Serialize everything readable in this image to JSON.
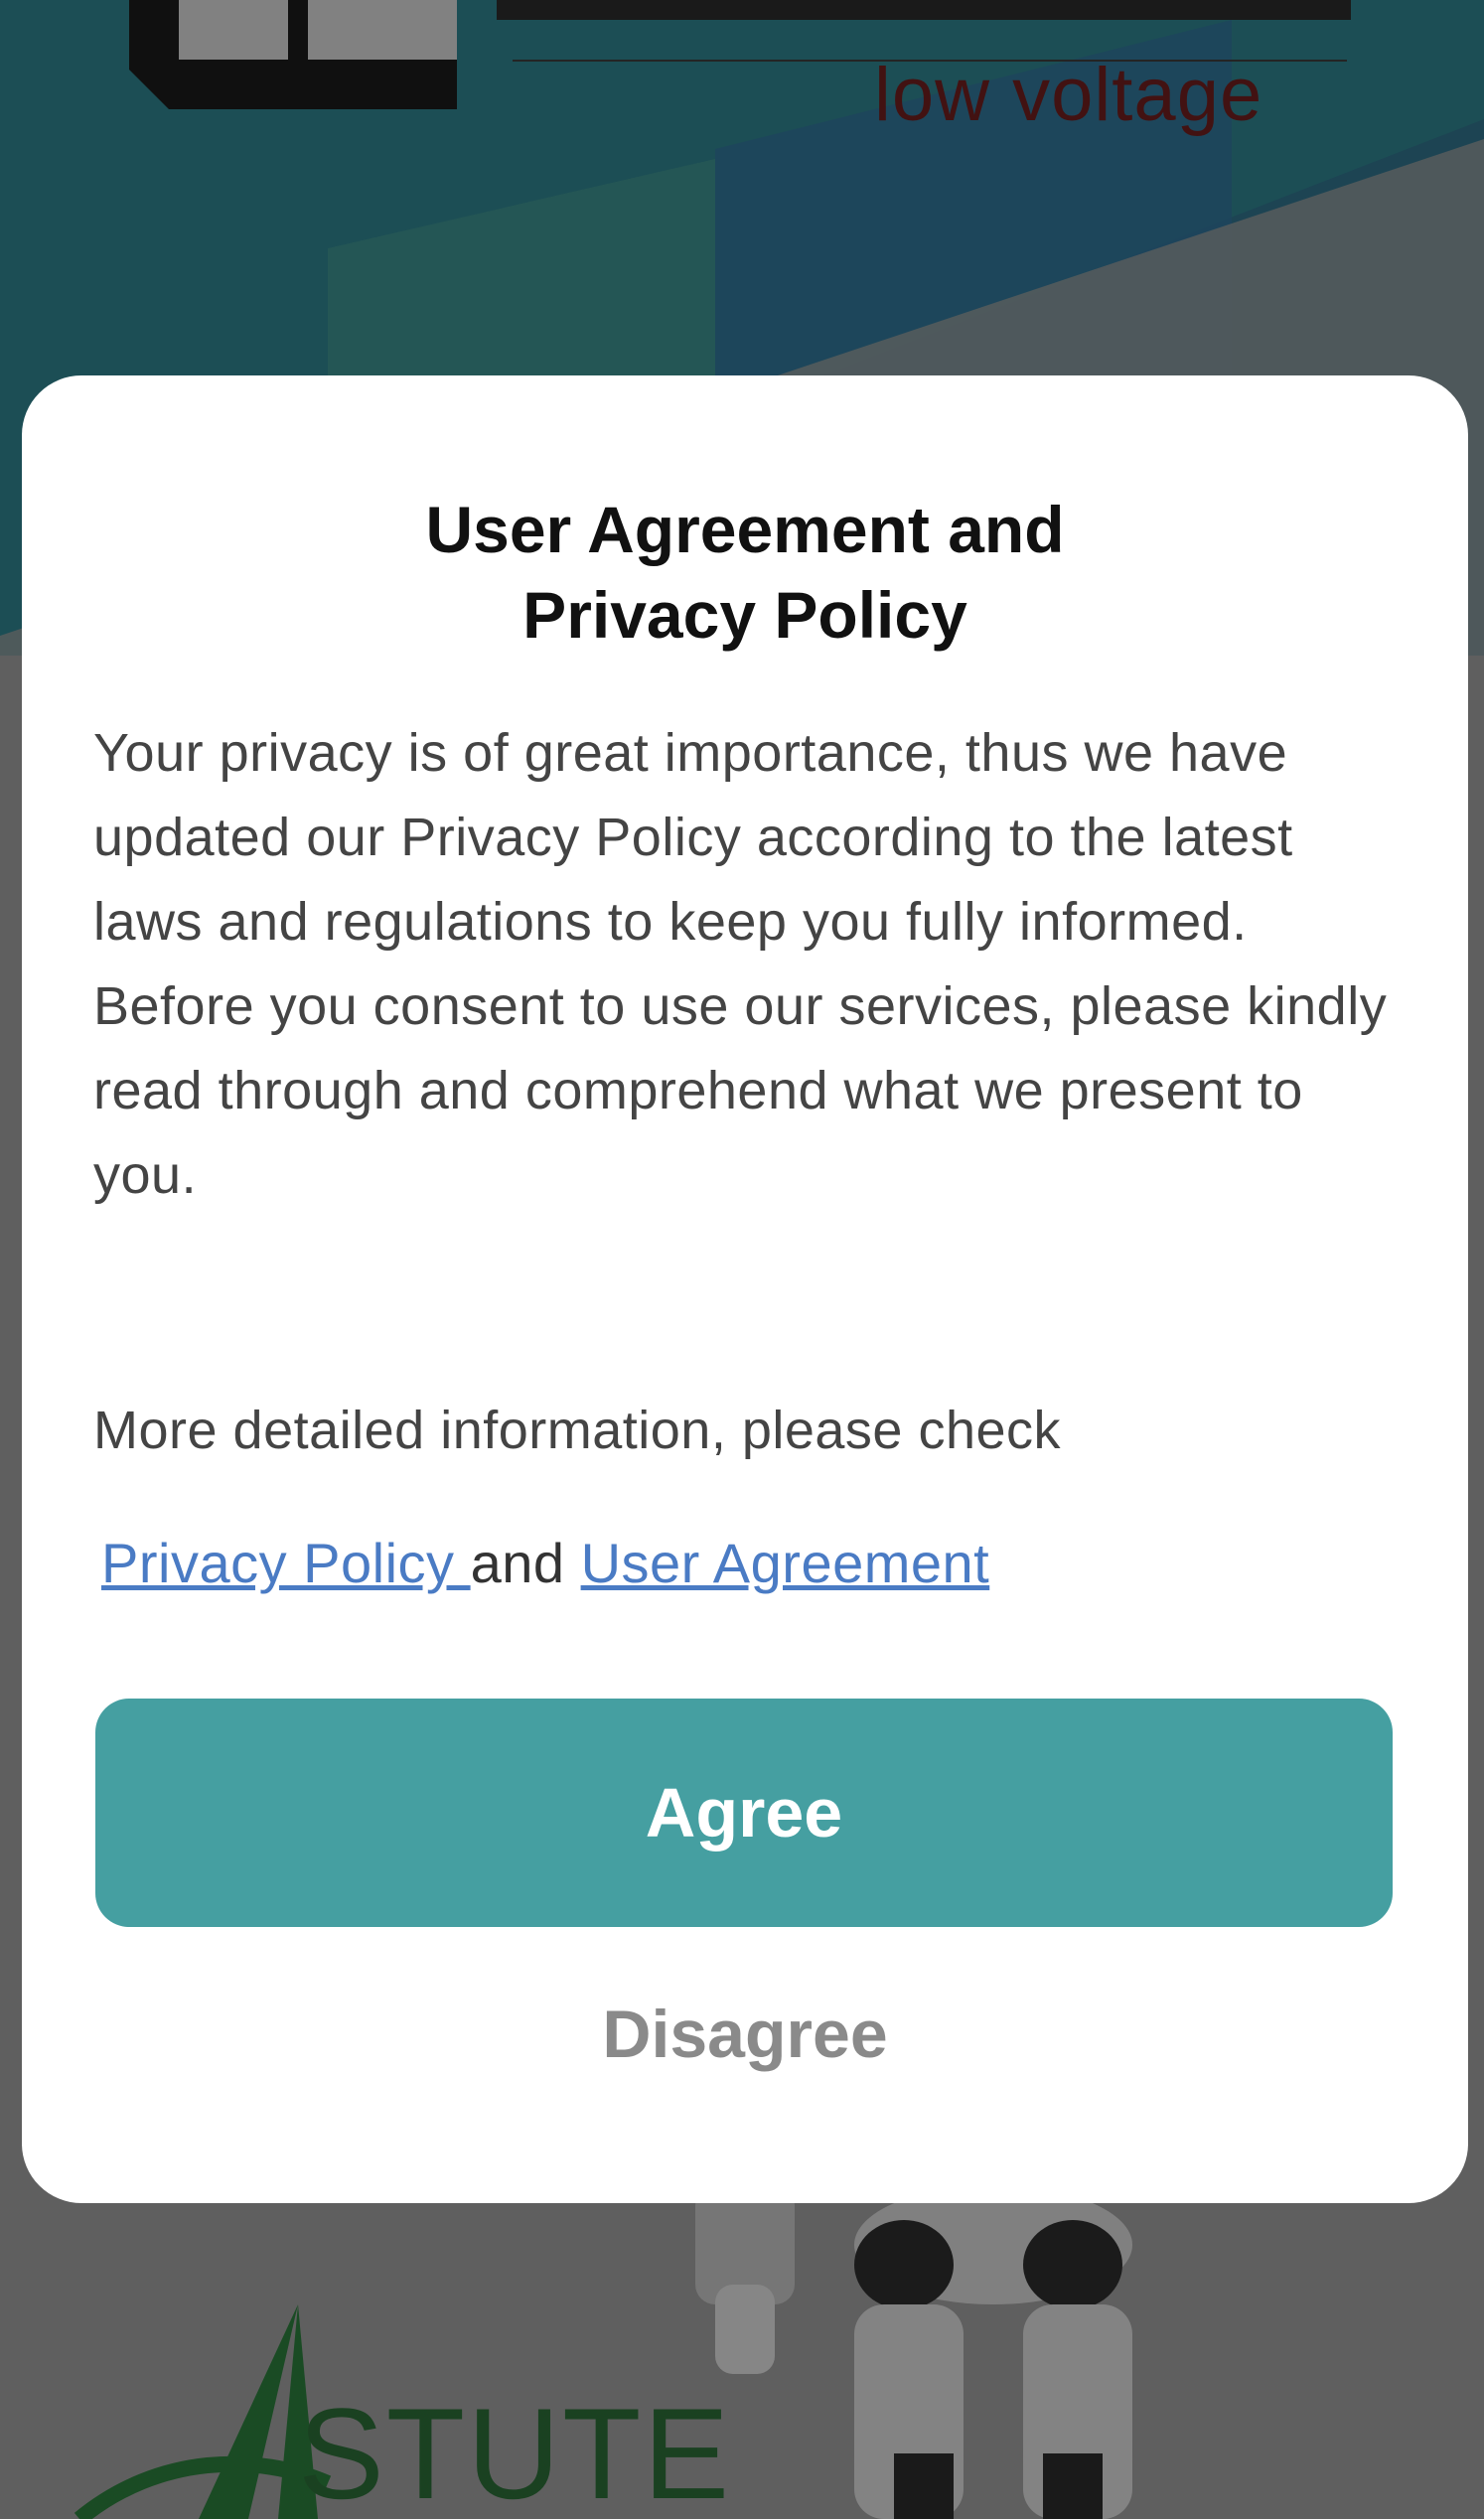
{
  "background": {
    "brand_tagline": "low voltage",
    "bottom_logo_text": "STUTE"
  },
  "dialog": {
    "title_line1": "User Agreement and",
    "title_line2": "Privacy Policy",
    "paragraph1": "Your privacy is of great importance, thus we have updated our Privacy Policy according to the latest laws and regulations to keep you fully informed.",
    "paragraph2": "Before you consent to use our services, please kindly read through and comprehend what we present to you.",
    "more_info": "More detailed information, please check",
    "privacy_link": "Privacy Policy ",
    "and_text": " and ",
    "user_agreement_link": "User Agreement",
    "agree_label": "Agree",
    "disagree_label": "Disagree"
  },
  "colors": {
    "accent": "#459fa1",
    "link": "#4a7bc4",
    "disagree_text": "#8a8a8a",
    "brand_red": "#8b1f1f",
    "astute_green": "#2a7a3a"
  }
}
